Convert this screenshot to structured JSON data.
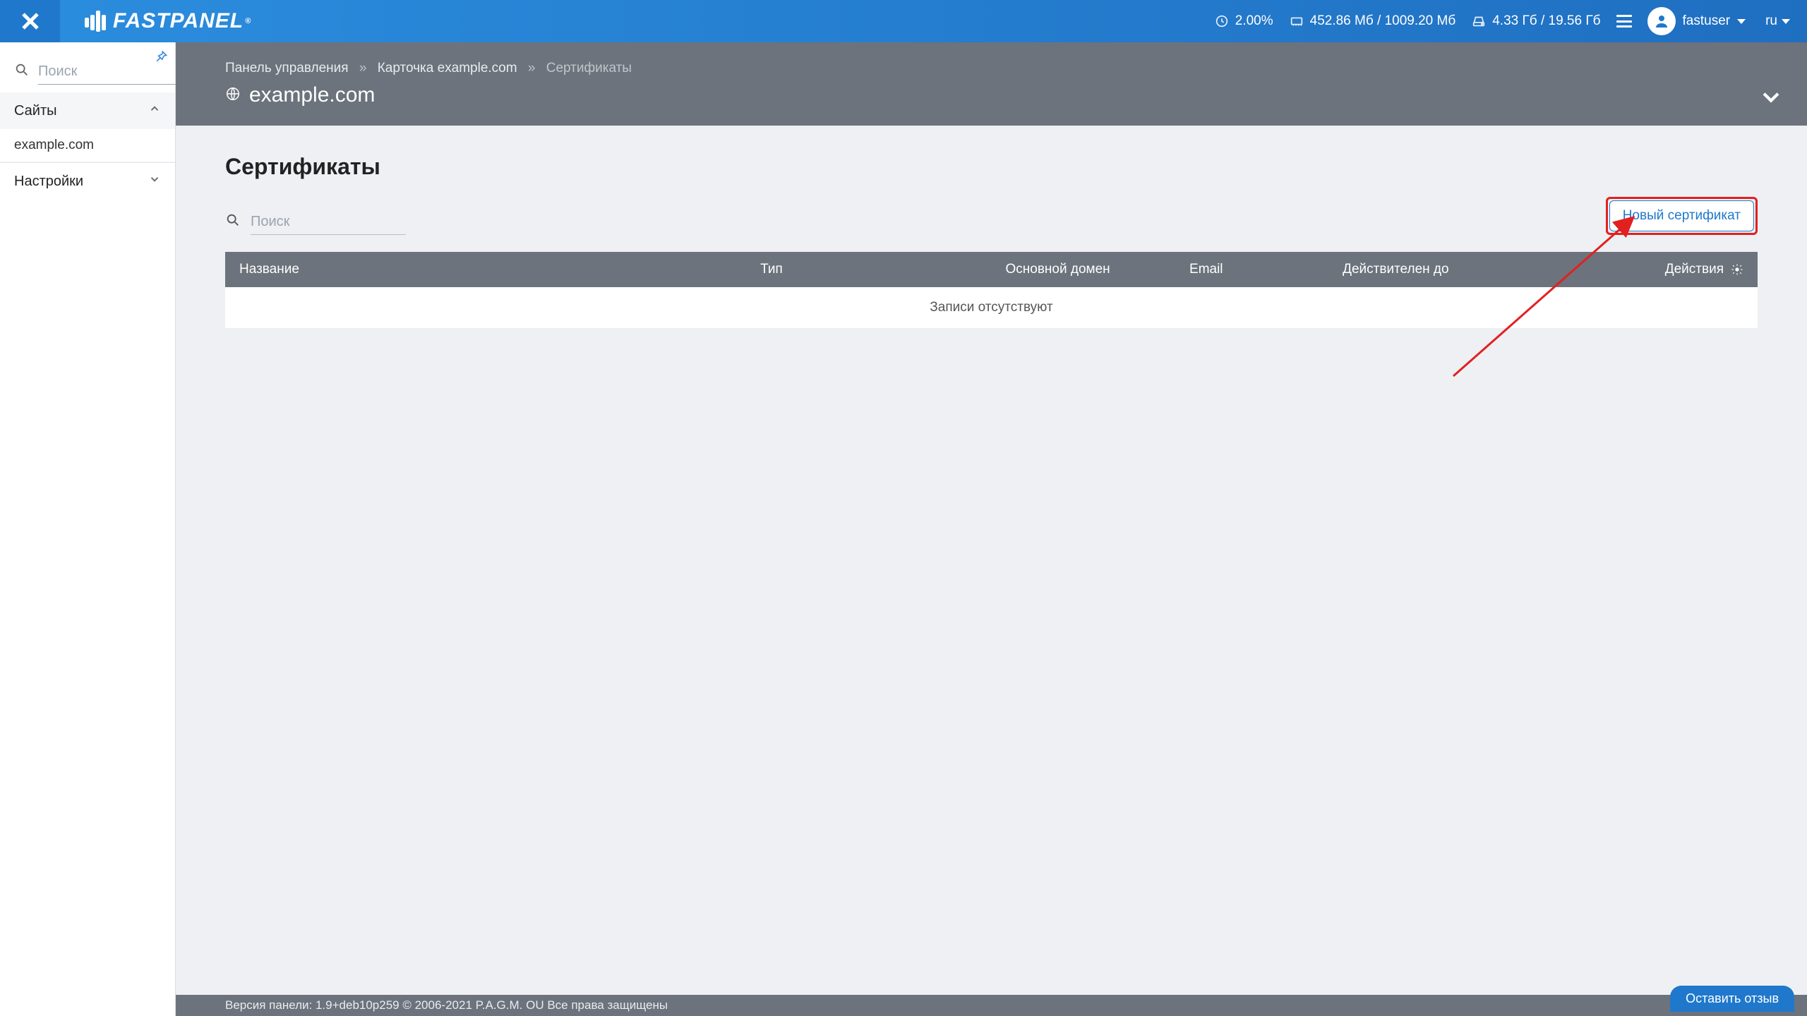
{
  "header": {
    "brand": "FASTPANEL",
    "brand_reg": "®",
    "stats": {
      "cpu": "2.00%",
      "mem": "452.86 Мб / 1009.20 Мб",
      "disk": "4.33 Гб / 19.56 Гб"
    },
    "username": "fastuser",
    "lang": "ru"
  },
  "sidebar": {
    "search_placeholder": "Поиск",
    "groups": {
      "sites": {
        "label": "Сайты",
        "expanded": true,
        "items": [
          "example.com"
        ]
      },
      "settings": {
        "label": "Настройки",
        "expanded": false
      }
    }
  },
  "subheader": {
    "breadcrumb": {
      "root": "Панель управления",
      "card": "Карточка example.com",
      "current": "Сертификаты",
      "sep": "»"
    },
    "site": "example.com"
  },
  "page": {
    "title": "Сертификаты",
    "search_placeholder": "Поиск",
    "new_cert_btn": "Новый сертификат",
    "table": {
      "columns": {
        "name": "Название",
        "type": "Тип",
        "main_domain": "Основной домен",
        "email": "Email",
        "valid_until": "Действителен до",
        "actions": "Действия"
      },
      "empty": "Записи отсутствуют"
    }
  },
  "footer": {
    "version": "Версия панели: 1.9+deb10p259 © 2006-2021 P.A.G.M. OU Все права защищены",
    "feedback": "Оставить отзыв"
  }
}
